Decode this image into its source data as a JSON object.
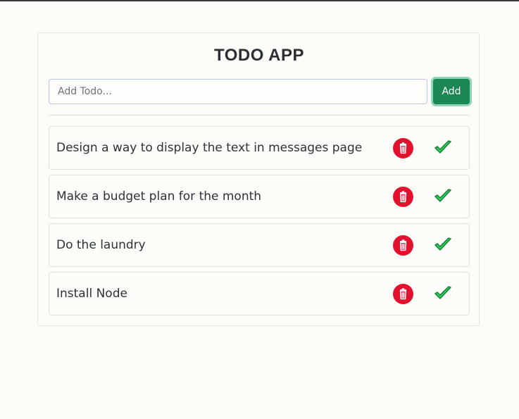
{
  "app": {
    "title": "TODO APP"
  },
  "form": {
    "input_placeholder": "Add Todo...",
    "input_value": "",
    "add_label": "Add"
  },
  "todos": [
    {
      "text": "Design a way to display the text in messages page"
    },
    {
      "text": "Make a budget plan for the month"
    },
    {
      "text": "Do the laundry"
    },
    {
      "text": "Install Node"
    }
  ],
  "icons": {
    "delete": "trash-icon",
    "complete": "checkmark-icon"
  },
  "colors": {
    "accent": "#1a8754",
    "delete": "#e3102e",
    "check": "#2fd35c"
  }
}
